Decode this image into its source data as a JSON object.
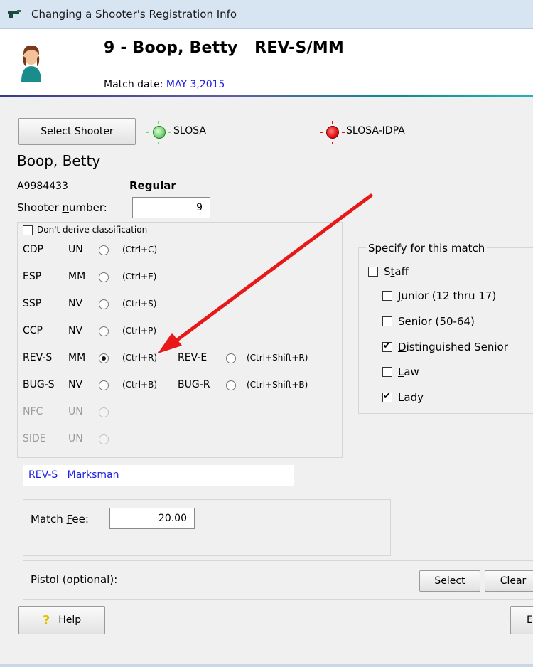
{
  "window": {
    "title": "Changing a Shooter's Registration Info"
  },
  "header": {
    "title": "9 - Boop, Betty   REV-S/MM",
    "match_date_label": "Match date:",
    "match_date_value": "MAY 3,2015"
  },
  "top": {
    "select_shooter_label": "Select Shooter",
    "indicator_1": {
      "label": "SLOSA",
      "color": "#74d174"
    },
    "indicator_2": {
      "label": "SLOSA-IDPA",
      "color": "#e01010"
    }
  },
  "shooter": {
    "name": "Boop, Betty",
    "id": "A9984433",
    "type": "Regular",
    "number_label_pre": "Shooter ",
    "number_label_mnemonic": "n",
    "number_label_post": "umber:",
    "number_value": "9"
  },
  "classification": {
    "dont_derive_label": "Don't derive classification",
    "dont_derive_checked": false,
    "rows": [
      {
        "div": "CDP",
        "cls": "UN",
        "shortcut": "(Ctrl+C)"
      },
      {
        "div": "ESP",
        "cls": "MM",
        "shortcut": "(Ctrl+E)"
      },
      {
        "div": "SSP",
        "cls": "NV",
        "shortcut": "(Ctrl+S)"
      },
      {
        "div": "CCP",
        "cls": "NV",
        "shortcut": "(Ctrl+P)"
      },
      {
        "div": "REV-S",
        "cls": "MM",
        "shortcut": "(Ctrl+R)",
        "selected": true,
        "div2": "REV-E",
        "shortcut2": "(Ctrl+Shift+R)"
      },
      {
        "div": "BUG-S",
        "cls": "NV",
        "shortcut": "(Ctrl+B)",
        "div2": "BUG-R",
        "shortcut2": "(Ctrl+Shift+B)"
      },
      {
        "div": "NFC",
        "cls": "UN",
        "disabled": true
      },
      {
        "div": "SIDE",
        "cls": "UN",
        "disabled": true
      }
    ],
    "result": "REV-S   Marksman"
  },
  "specify": {
    "title": "Specify for this match",
    "staff": {
      "pre": "S",
      "mn": "t",
      "post": "aff",
      "checked": false
    },
    "items": [
      {
        "mn": "J",
        "post": "unior (12 thru 17)",
        "checked": false
      },
      {
        "mn": "S",
        "post": "enior (50-64)",
        "checked": false
      },
      {
        "mn": "D",
        "post": "istinguished Senior",
        "checked": true
      },
      {
        "mn": "L",
        "post": "aw",
        "checked": false
      },
      {
        "pre": "L",
        "mn": "a",
        "post": "dy",
        "checked": true
      }
    ]
  },
  "fee": {
    "label_pre": "Match ",
    "label_mn": "F",
    "label_post": "ee:",
    "value": "20.00"
  },
  "pistol": {
    "label": "Pistol (optional):",
    "select_pre": "S",
    "select_mn": "e",
    "select_post": "lect",
    "clear_label": "Clear"
  },
  "footer": {
    "help_mn": "H",
    "help_post": "elp",
    "right_button_mn": "E"
  },
  "colors": {
    "accent_blue": "#1e1ee0",
    "arrow_red": "#e81818"
  }
}
